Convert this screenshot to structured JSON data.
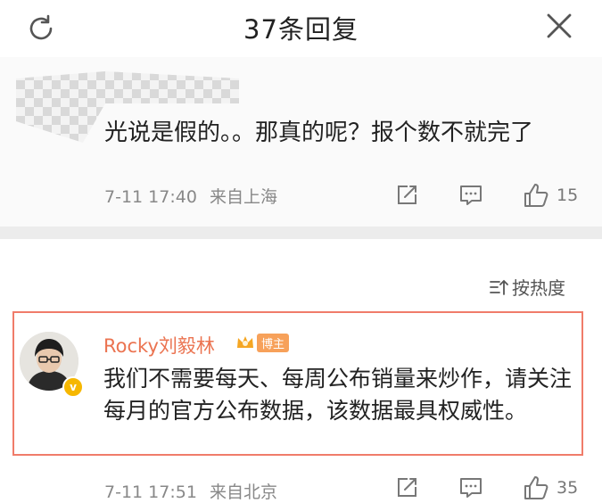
{
  "header": {
    "title": "37条回复",
    "refresh_icon": "refresh-icon",
    "close_icon": "close-icon"
  },
  "comment1": {
    "text": "光说是假的。。那真的呢？报个数不就完了",
    "time": "7-11 17:40",
    "location": "来自上海",
    "likes": "15"
  },
  "sort": {
    "label": "按热度"
  },
  "comment2": {
    "username": "Rocky刘毅林",
    "badge": "博主",
    "text": "我们不需要每天、每周公布销量来炒作，请关注每月的官方公布数据，该数据最具权威性。",
    "time": "7-11 17:51",
    "location": "来自北京",
    "likes": "35"
  },
  "colors": {
    "username": "#eb7350",
    "highlight_border": "#f07c6a",
    "verified": "#f6b700"
  }
}
